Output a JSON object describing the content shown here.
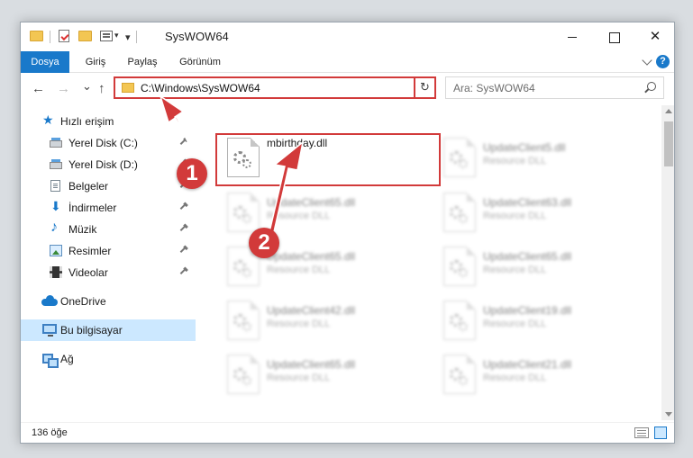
{
  "window": {
    "title": "SysWOW64",
    "controls": {
      "minimize": "",
      "maximize": "",
      "close": "✕"
    }
  },
  "ribbon": {
    "tabs": [
      "Dosya",
      "Giriş",
      "Paylaş",
      "Görünüm"
    ],
    "help": "?"
  },
  "navigation": {
    "address": "C:\\Windows\\SysWOW64",
    "refresh": "↻",
    "search_placeholder": "Ara: SysWOW64",
    "back": "←",
    "forward": "→",
    "recent": "⌄",
    "up": "↑"
  },
  "sidebar": {
    "items": [
      {
        "label": "Hızlı erişim",
        "icon": "star-icon"
      },
      {
        "label": "Yerel Disk (C:)",
        "icon": "disk-icon",
        "pinned": true
      },
      {
        "label": "Yerel Disk (D:)",
        "icon": "disk-icon",
        "pinned": true
      },
      {
        "label": "Belgeler",
        "icon": "document-icon",
        "pinned": true
      },
      {
        "label": "İndirmeler",
        "icon": "download-icon",
        "pinned": true
      },
      {
        "label": "Müzik",
        "icon": "music-icon",
        "pinned": true
      },
      {
        "label": "Resimler",
        "icon": "pictures-icon",
        "pinned": true
      },
      {
        "label": "Videolar",
        "icon": "video-icon",
        "pinned": true
      },
      {
        "label": "OneDrive",
        "icon": "cloud-icon"
      },
      {
        "label": "Bu bilgisayar",
        "icon": "computer-icon",
        "selected": true
      },
      {
        "label": "Ağ",
        "icon": "network-icon"
      }
    ]
  },
  "files": [
    {
      "name": "mbirthday.dll",
      "type": "",
      "focused": true
    },
    {
      "name": "UpdateClient5.dll",
      "type": "Resource DLL"
    },
    {
      "name": "UpdateClient65.dll",
      "type": "Resource DLL"
    },
    {
      "name": "UpdateClient63.dll",
      "type": "Resource DLL"
    },
    {
      "name": "UpdateClient65.dll",
      "type": "Resource DLL"
    },
    {
      "name": "UpdateClient65.dll",
      "type": "Resource DLL"
    },
    {
      "name": "UpdateClient42.dll",
      "type": "Resource DLL"
    },
    {
      "name": "UpdateClient19.dll",
      "type": "Resource DLL"
    },
    {
      "name": "UpdateClient65.dll",
      "type": "Resource DLL"
    },
    {
      "name": "UpdateClient21.dll",
      "type": "Resource DLL"
    }
  ],
  "status": {
    "item_count": "136 öğe"
  },
  "annotations": {
    "step1": "1",
    "step2": "2",
    "color": "#d23a3a"
  }
}
